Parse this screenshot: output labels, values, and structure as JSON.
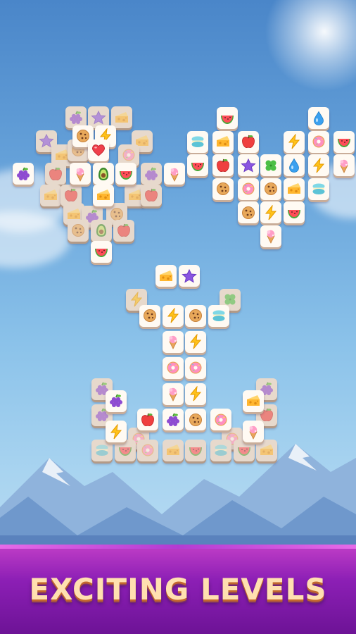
{
  "banner": {
    "title": "EXCITING LEVELS"
  },
  "colors": {
    "sky_top": "#4a86c9",
    "banner": "#8c1fb5",
    "title_text": "#ffe0b0"
  },
  "tile_types": [
    "grapes",
    "star",
    "cheese",
    "cookie",
    "lightning",
    "heart",
    "icecream",
    "avocado",
    "watermelon",
    "donut",
    "apple",
    "macaron",
    "clover",
    "water-drop"
  ],
  "boards": [
    {
      "name": "heart-cluster",
      "tiles": [
        {
          "col": 2.3,
          "row": 0,
          "icon": "grapes",
          "layer": "back"
        },
        {
          "col": 3.3,
          "row": 0,
          "icon": "star",
          "layer": "back"
        },
        {
          "col": 4.3,
          "row": 0,
          "icon": "cheese",
          "layer": "back"
        },
        {
          "col": 1,
          "row": 1,
          "icon": "star",
          "layer": "back"
        },
        {
          "col": 2.6,
          "row": 0.8,
          "icon": "cookie",
          "layer": "front"
        },
        {
          "col": 3.6,
          "row": 0.8,
          "icon": "lightning",
          "layer": "front"
        },
        {
          "col": 5.2,
          "row": 1,
          "icon": "cheese",
          "layer": "back"
        },
        {
          "col": 1.7,
          "row": 1.6,
          "icon": "cheese",
          "layer": "back"
        },
        {
          "col": 2.4,
          "row": 1.4,
          "icon": "cookie",
          "layer": "back"
        },
        {
          "col": 3.3,
          "row": 1.4,
          "icon": "heart",
          "layer": "front"
        },
        {
          "col": 4.6,
          "row": 1.6,
          "icon": "donut",
          "layer": "back"
        },
        {
          "col": 0,
          "row": 2.4,
          "icon": "grapes",
          "layer": "front"
        },
        {
          "col": 1.4,
          "row": 2.4,
          "icon": "apple",
          "layer": "back"
        },
        {
          "col": 2.5,
          "row": 2.4,
          "icon": "icecream",
          "layer": "front"
        },
        {
          "col": 3.5,
          "row": 2.4,
          "icon": "avocado",
          "layer": "front"
        },
        {
          "col": 4.5,
          "row": 2.4,
          "icon": "watermelon",
          "layer": "front"
        },
        {
          "col": 5.6,
          "row": 2.4,
          "icon": "grapes",
          "layer": "back"
        },
        {
          "col": 6.6,
          "row": 2.4,
          "icon": "icecream",
          "layer": "front"
        },
        {
          "col": 1.2,
          "row": 3.3,
          "icon": "cheese",
          "layer": "back"
        },
        {
          "col": 2.1,
          "row": 3.3,
          "icon": "apple",
          "layer": "back"
        },
        {
          "col": 3.5,
          "row": 3.3,
          "icon": "cheese",
          "layer": "front"
        },
        {
          "col": 4.9,
          "row": 3.3,
          "icon": "cheese",
          "layer": "back"
        },
        {
          "col": 5.6,
          "row": 3.3,
          "icon": "apple",
          "layer": "back"
        },
        {
          "col": 2.2,
          "row": 4.1,
          "icon": "cheese",
          "layer": "back"
        },
        {
          "col": 3.0,
          "row": 4.2,
          "icon": "grapes",
          "layer": "back"
        },
        {
          "col": 4.1,
          "row": 4.1,
          "icon": "cookie",
          "layer": "back"
        },
        {
          "col": 2.4,
          "row": 4.8,
          "icon": "cookie",
          "layer": "back"
        },
        {
          "col": 3.4,
          "row": 4.8,
          "icon": "avocado",
          "layer": "back"
        },
        {
          "col": 4.4,
          "row": 4.8,
          "icon": "apple",
          "layer": "back"
        },
        {
          "col": 3.4,
          "row": 5.7,
          "icon": "watermelon",
          "layer": "front"
        }
      ]
    },
    {
      "name": "heart-pattern",
      "tiles": [
        {
          "col": 1.3,
          "row": 0,
          "icon": "watermelon",
          "layer": "front"
        },
        {
          "col": 5.3,
          "row": 0,
          "icon": "water-drop",
          "layer": "front"
        },
        {
          "col": 0,
          "row": 1,
          "icon": "macaron",
          "layer": "front"
        },
        {
          "col": 1.1,
          "row": 1,
          "icon": "cheese",
          "layer": "front"
        },
        {
          "col": 2.2,
          "row": 1,
          "icon": "apple",
          "layer": "front"
        },
        {
          "col": 4.2,
          "row": 1,
          "icon": "lightning",
          "layer": "front"
        },
        {
          "col": 5.3,
          "row": 1,
          "icon": "donut",
          "layer": "front"
        },
        {
          "col": 6.4,
          "row": 1,
          "icon": "watermelon",
          "layer": "front"
        },
        {
          "col": 0,
          "row": 2,
          "icon": "watermelon",
          "layer": "front"
        },
        {
          "col": 1.1,
          "row": 2,
          "icon": "apple",
          "layer": "front"
        },
        {
          "col": 2.2,
          "row": 2,
          "icon": "star",
          "layer": "front"
        },
        {
          "col": 3.2,
          "row": 2,
          "icon": "clover",
          "layer": "front"
        },
        {
          "col": 4.2,
          "row": 2,
          "icon": "water-drop",
          "layer": "front"
        },
        {
          "col": 5.3,
          "row": 2,
          "icon": "lightning",
          "layer": "front"
        },
        {
          "col": 6.4,
          "row": 2,
          "icon": "icecream",
          "layer": "front"
        },
        {
          "col": 1.1,
          "row": 3,
          "icon": "cookie",
          "layer": "front"
        },
        {
          "col": 2.2,
          "row": 3,
          "icon": "donut",
          "layer": "front"
        },
        {
          "col": 3.2,
          "row": 3,
          "icon": "cookie",
          "layer": "front"
        },
        {
          "col": 4.2,
          "row": 3,
          "icon": "cheese",
          "layer": "front"
        },
        {
          "col": 5.3,
          "row": 3,
          "icon": "macaron",
          "layer": "front"
        },
        {
          "col": 2.2,
          "row": 4,
          "icon": "cookie",
          "layer": "front"
        },
        {
          "col": 3.2,
          "row": 4,
          "icon": "lightning",
          "layer": "front"
        },
        {
          "col": 4.2,
          "row": 4,
          "icon": "watermelon",
          "layer": "front"
        },
        {
          "col": 3.2,
          "row": 5,
          "icon": "icecream",
          "layer": "front"
        }
      ]
    },
    {
      "name": "anchor-pattern",
      "tiles": [
        {
          "col": 2.8,
          "row": 0,
          "icon": "cheese",
          "layer": "front"
        },
        {
          "col": 3.8,
          "row": 0,
          "icon": "star",
          "layer": "front"
        },
        {
          "col": 1.5,
          "row": 1,
          "icon": "lightning",
          "layer": "back"
        },
        {
          "col": 5.6,
          "row": 1,
          "icon": "clover",
          "layer": "back"
        },
        {
          "col": 2.1,
          "row": 1.7,
          "icon": "cookie",
          "layer": "front"
        },
        {
          "col": 3.1,
          "row": 1.7,
          "icon": "lightning",
          "layer": "front"
        },
        {
          "col": 4.1,
          "row": 1.7,
          "icon": "cookie",
          "layer": "front"
        },
        {
          "col": 5.1,
          "row": 1.7,
          "icon": "macaron",
          "layer": "front"
        },
        {
          "col": 3.1,
          "row": 2.8,
          "icon": "icecream",
          "layer": "front"
        },
        {
          "col": 4.1,
          "row": 2.8,
          "icon": "lightning",
          "layer": "front"
        },
        {
          "col": 3.1,
          "row": 3.9,
          "icon": "donut",
          "layer": "front"
        },
        {
          "col": 4.1,
          "row": 3.9,
          "icon": "donut",
          "layer": "front"
        },
        {
          "col": 0,
          "row": 4.8,
          "icon": "grapes",
          "layer": "back"
        },
        {
          "col": 7.2,
          "row": 4.8,
          "icon": "grapes",
          "layer": "back"
        },
        {
          "col": 3.1,
          "row": 5.0,
          "icon": "icecream",
          "layer": "front"
        },
        {
          "col": 4.1,
          "row": 5.0,
          "icon": "lightning",
          "layer": "front"
        },
        {
          "col": 0.6,
          "row": 5.3,
          "icon": "grapes",
          "layer": "front"
        },
        {
          "col": 6.6,
          "row": 5.3,
          "icon": "cheese",
          "layer": "front"
        },
        {
          "col": 0,
          "row": 5.9,
          "icon": "grapes",
          "layer": "back"
        },
        {
          "col": 2.0,
          "row": 6.1,
          "icon": "apple",
          "layer": "front"
        },
        {
          "col": 3.1,
          "row": 6.1,
          "icon": "grapes",
          "layer": "front"
        },
        {
          "col": 4.1,
          "row": 6.1,
          "icon": "cookie",
          "layer": "front"
        },
        {
          "col": 5.2,
          "row": 6.1,
          "icon": "donut",
          "layer": "front"
        },
        {
          "col": 7.2,
          "row": 5.9,
          "icon": "apple",
          "layer": "back"
        },
        {
          "col": 0.6,
          "row": 6.6,
          "icon": "lightning",
          "layer": "front"
        },
        {
          "col": 1.6,
          "row": 6.9,
          "icon": "donut",
          "layer": "back"
        },
        {
          "col": 5.7,
          "row": 6.9,
          "icon": "donut",
          "layer": "back"
        },
        {
          "col": 6.6,
          "row": 6.6,
          "icon": "icecream",
          "layer": "front"
        },
        {
          "col": 0,
          "row": 7.4,
          "icon": "macaron",
          "layer": "back"
        },
        {
          "col": 1.0,
          "row": 7.4,
          "icon": "watermelon",
          "layer": "back"
        },
        {
          "col": 2.0,
          "row": 7.4,
          "icon": "donut",
          "layer": "back"
        },
        {
          "col": 3.1,
          "row": 7.4,
          "icon": "cheese",
          "layer": "back"
        },
        {
          "col": 4.1,
          "row": 7.4,
          "icon": "watermelon",
          "layer": "back"
        },
        {
          "col": 5.2,
          "row": 7.4,
          "icon": "macaron",
          "layer": "back"
        },
        {
          "col": 6.2,
          "row": 7.4,
          "icon": "watermelon",
          "layer": "back"
        },
        {
          "col": 7.2,
          "row": 7.4,
          "icon": "cheese",
          "layer": "back"
        }
      ]
    }
  ]
}
